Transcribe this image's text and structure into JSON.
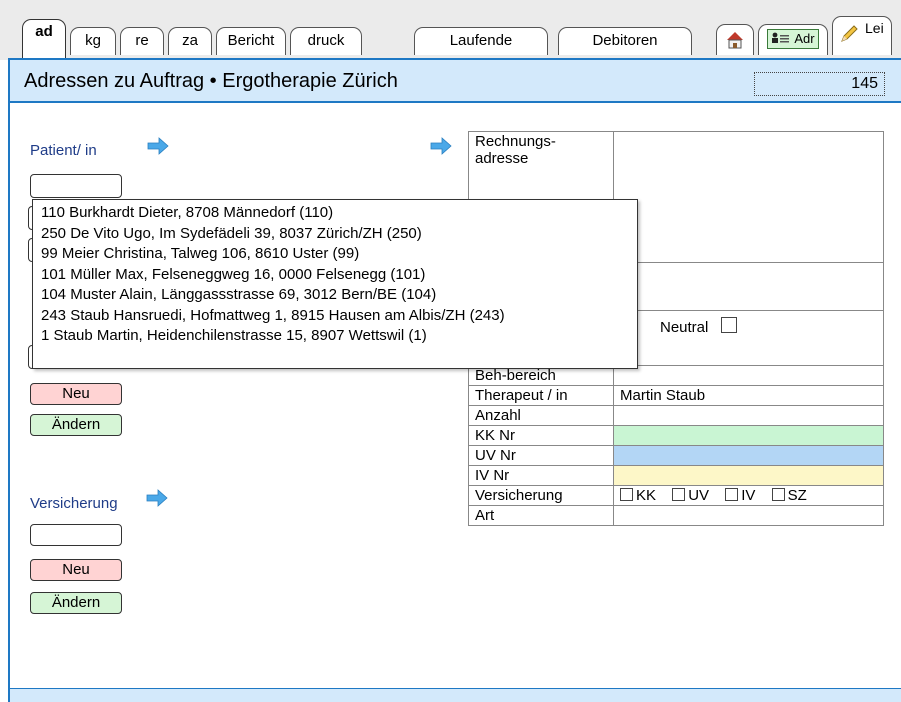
{
  "tabs": [
    {
      "label": "ad",
      "active": true
    },
    {
      "label": "kg"
    },
    {
      "label": "re"
    },
    {
      "label": "za"
    },
    {
      "label": "Bericht"
    },
    {
      "label": "druck"
    },
    {
      "label": "Laufende"
    },
    {
      "label": "Debitoren"
    }
  ],
  "right_tabs": {
    "home_icon": "home-icon",
    "adr_icon": "address-card-icon",
    "adr_label": "Adr",
    "lei_icon": "pencil-icon",
    "lei_label": "Lei"
  },
  "header": {
    "title": "Adressen zu Auftrag •  Ergotherapie Zürich",
    "count": "145"
  },
  "patient": {
    "label": "Patient/ in",
    "input_value": ""
  },
  "dropdown": {
    "items": [
      "110 Burkhardt Dieter, 8708 Männedorf (110)",
      "250 De Vito Ugo, Im Sydefädeli 39, 8037 Zürich/ZH (250)",
      "99 Meier Christina, Talweg 106, 8610 Uster (99)",
      "101 Müller Max, Felseneggweg 16, 0000 Felsenegg (101)",
      "104 Muster Alain, Länggassstrasse 69, 3012 Bern/BE (104)",
      "243 Staub Hansruedi, Hofmattweg 1, 8915 Hausen am Albis/ZH (243)",
      "1 Staub Martin, Heidenchilenstrasse 15, 8907 Wettswil (1)"
    ]
  },
  "buttons": {
    "neu": "Neu",
    "aendern": "Ändern"
  },
  "versicherung": {
    "label": "Versicherung",
    "input_value": ""
  },
  "form": {
    "rechnungsadresse": "Rechnungs-\nadresse",
    "neutral": "Neutral",
    "beh_bereich": "Beh-bereich",
    "therapeut_label": "Therapeut / in",
    "therapeut_value": "Martin Staub",
    "anzahl": "Anzahl",
    "kk_nr": "KK Nr",
    "uv_nr": "UV Nr",
    "iv_nr": "IV Nr",
    "versicherung": "Versicherung",
    "art": "Art",
    "checks": [
      "KK",
      "UV",
      "IV",
      "SZ"
    ]
  },
  "colors": {
    "accent": "#1e78c4",
    "header_bg": "#d3e9fb",
    "kk_bg": "#c9f5d3",
    "uv_bg": "#b3d6f5",
    "iv_bg": "#fdf7c8",
    "neu_bg": "#ffd3d3",
    "aendern_bg": "#d6f5d6"
  }
}
